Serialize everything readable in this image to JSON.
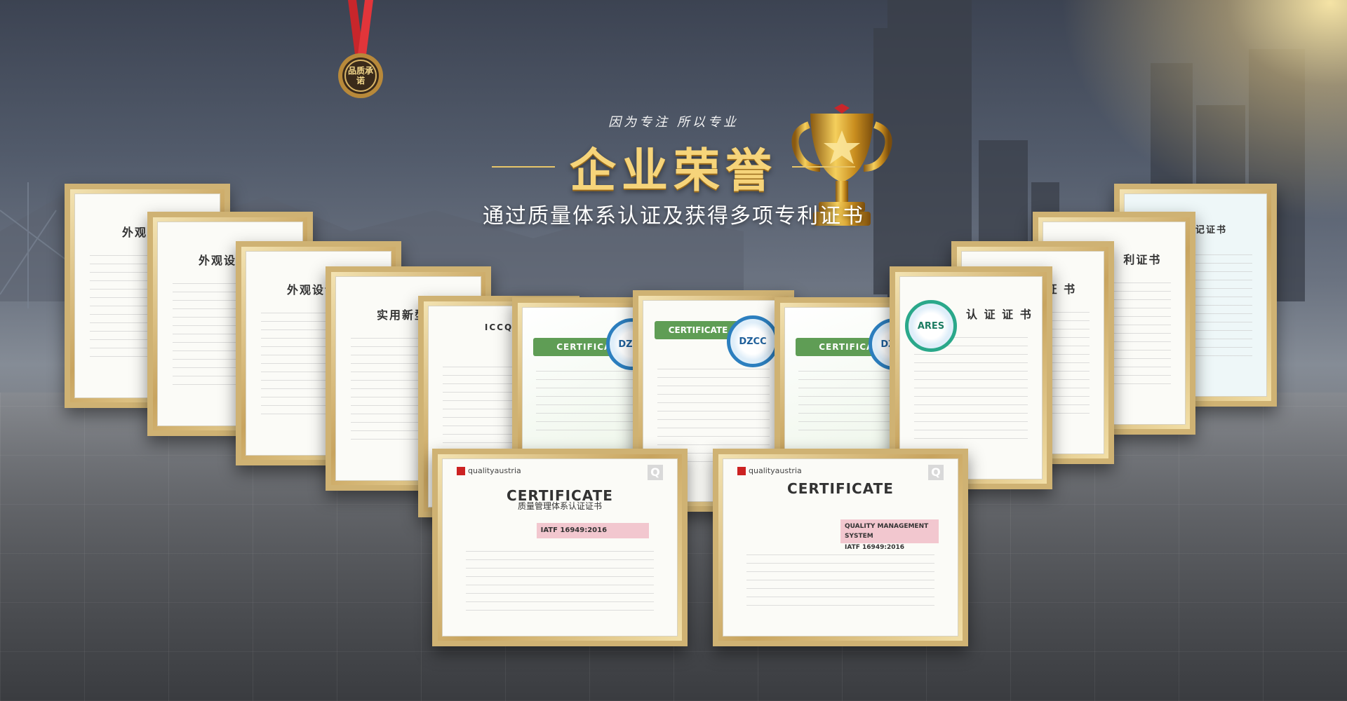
{
  "banner": {
    "slogan": "因为专注 所以专业",
    "title": "企业荣誉",
    "subtitle": "通过质量体系认证及获得多项专利证书",
    "medal_text": "品质承诺"
  },
  "colors": {
    "title_gold": "#f6d47a",
    "frame_gold": "#cfb273",
    "ribbon_red": "#c8262b"
  },
  "certificates": [
    {
      "title": "外观设计",
      "type": "patent"
    },
    {
      "title": "外观设计专",
      "type": "patent"
    },
    {
      "title": "外观设计专",
      "type": "patent"
    },
    {
      "title": "实用新型专",
      "type": "patent"
    },
    {
      "title": "ICCQ",
      "type": "rohs"
    },
    {
      "title": "CERTIFICATE",
      "type": "dzcc"
    },
    {
      "title": "CERTIFICATE",
      "type": "dzcc"
    },
    {
      "title": "CERTIFICATE",
      "type": "dzcc"
    },
    {
      "title": "认 证 证 书",
      "type": "ares"
    },
    {
      "title": "证 书",
      "type": "iso"
    },
    {
      "title": "利证书",
      "type": "patent"
    },
    {
      "title": "作权登记证书",
      "type": "software"
    }
  ],
  "front_certificates": [
    {
      "brand": "qualityaustria",
      "title": "CERTIFICATE",
      "subtitle": "质量管理体系认证证书",
      "standard": "IATF 16949:2016"
    },
    {
      "brand": "qualityaustria",
      "title": "CERTIFICATE",
      "subtitle": "QUALITY MANAGEMENT SYSTEM",
      "standard": "IATF 16949:2016"
    }
  ],
  "seals": [
    "DZCC",
    "DZCC",
    "DZCC",
    "ARES"
  ]
}
